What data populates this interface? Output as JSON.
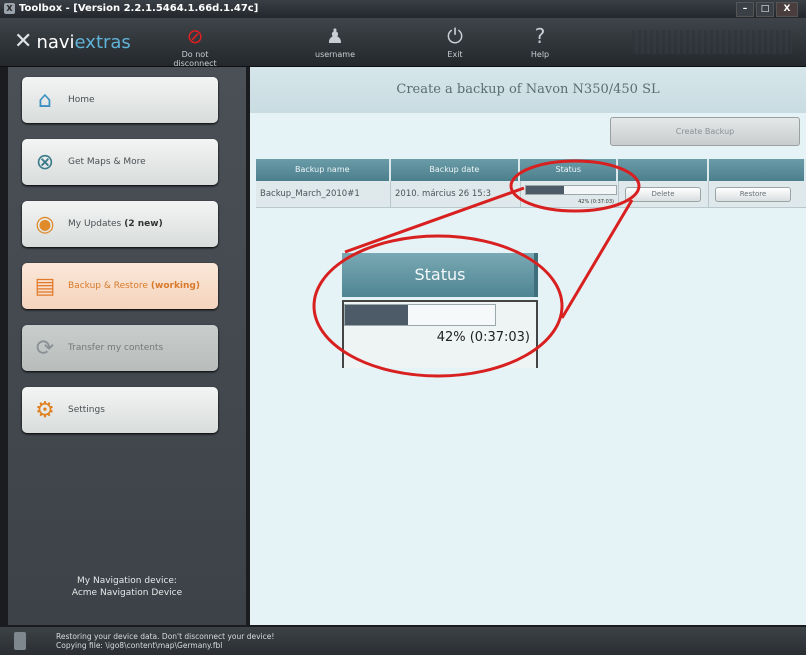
{
  "window": {
    "title": "Toolbox - [Version 2.2.1.5464.1.66d.1.47c]",
    "min": "–",
    "max": "□",
    "close": "X"
  },
  "toolbar": {
    "logo_prefix": "navi",
    "logo_suffix": "extras",
    "do_not_disconnect": "Do not disconnect",
    "username": "username",
    "exit": "Exit",
    "help": "Help",
    "icons": {
      "disconnect": "no-entry-icon",
      "user": "user-icon",
      "exit": "power-icon",
      "help": "question-icon"
    }
  },
  "sidebar": {
    "items": [
      {
        "label": "Home",
        "tag": "",
        "icon": "⌂"
      },
      {
        "label": "Get Maps & More",
        "tag": "",
        "icon": "⊗"
      },
      {
        "label": "My Updates",
        "tag": "(2 new)",
        "icon": "◉"
      },
      {
        "label": "Backup & Restore",
        "tag": "(working)",
        "icon": "▤"
      },
      {
        "label": "Transfer my contents",
        "tag": "",
        "icon": "⟳"
      },
      {
        "label": "Settings",
        "tag": "",
        "icon": "⚙"
      }
    ],
    "device_label": "My Navigation device:",
    "device_name": "Acme Navigation Device"
  },
  "main": {
    "title": "Create a backup of Navon N350/450 SL",
    "create_backup": "Create Backup",
    "columns": [
      "Backup name",
      "Backup date",
      "Status",
      "",
      ""
    ],
    "rows": [
      {
        "name": "Backup_March_2010#1",
        "date": "2010. március 26 15:3",
        "progress": 42,
        "progress_text": "42% (0:37:03)",
        "delete": "Delete",
        "restore": "Restore"
      }
    ],
    "zoom": {
      "header": "Status",
      "progress": 42,
      "text": "42% (0:37:03)"
    }
  },
  "statusbar": {
    "line1": "Restoring your device data. Don't disconnect your device!",
    "line2": "Copying file: \\igo8\\content\\map\\Germany.fbl"
  },
  "colors": {
    "accent": "#d87a2c",
    "grid_header": "#5a8d9a",
    "callout": "#d82020",
    "progress": "#4d5a68"
  }
}
